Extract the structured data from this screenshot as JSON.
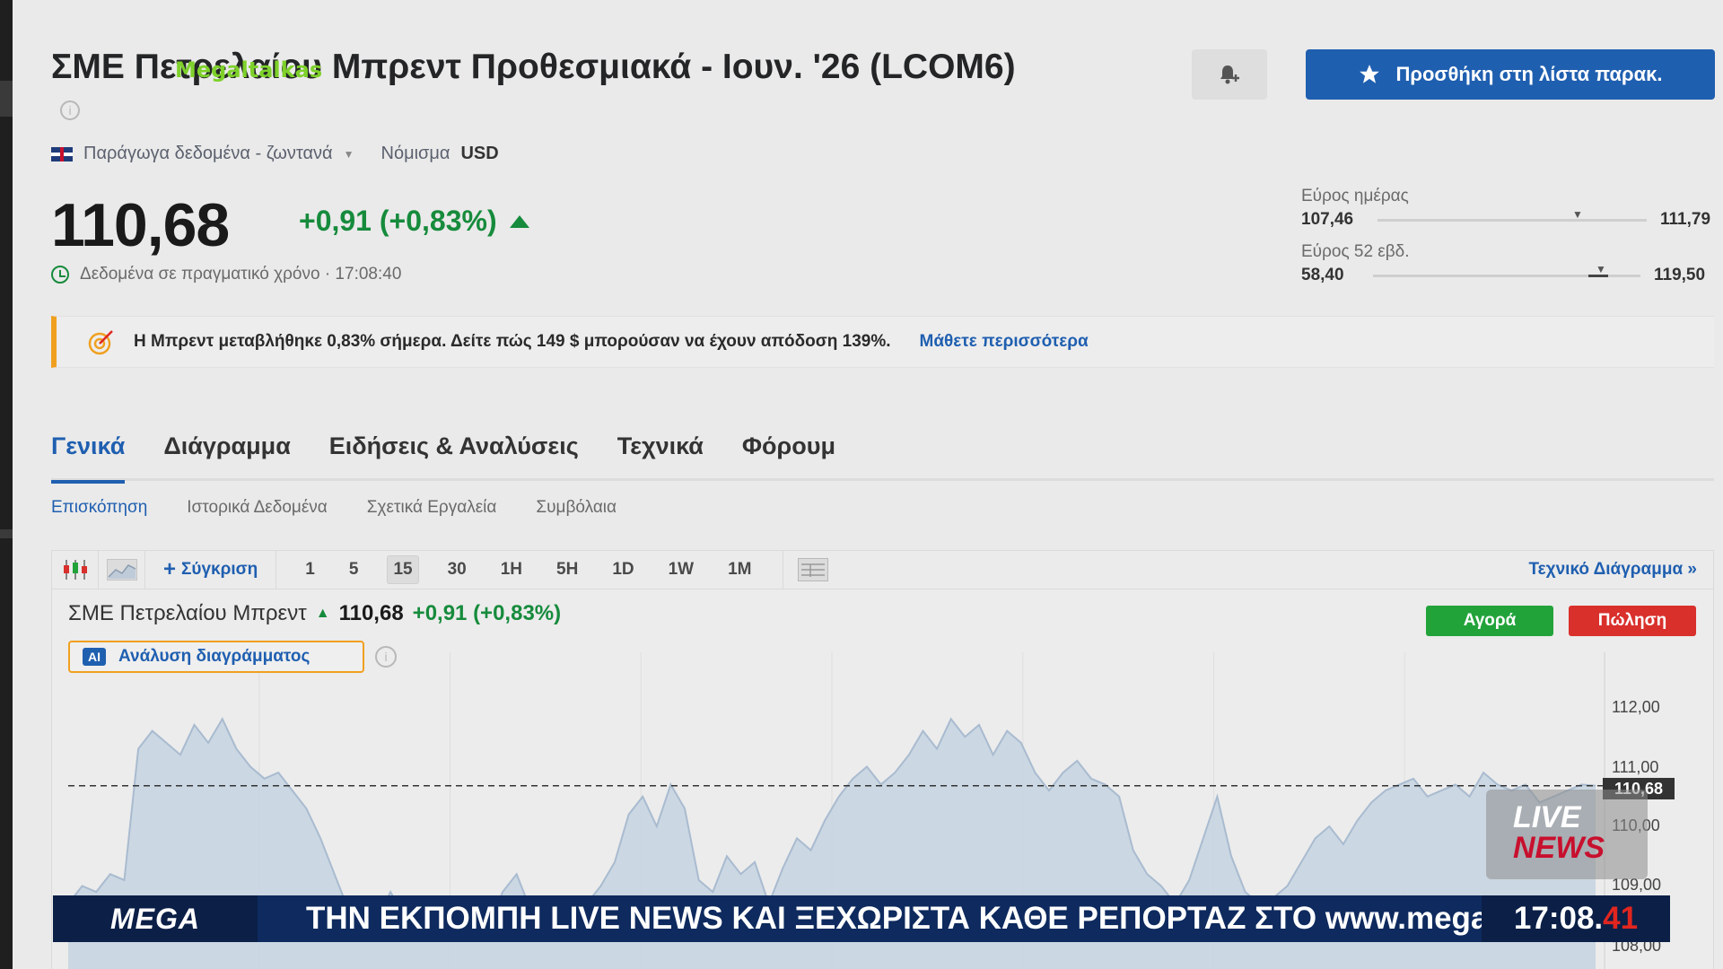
{
  "header": {
    "title": "ΣΜΕ Πετρελαίου Μπρεντ Προθεσμιακά - Ιουν. '26 (LCOM6)",
    "overlay_logo": "Megaltalkas",
    "watchlist_label": "Προσθήκη στη λίστα παρακ.",
    "data_source": "Παράγωγα δεδομένα - ζωντανά",
    "currency_label": "Νόμισμα",
    "currency_value": "USD"
  },
  "quote": {
    "price": "110,68",
    "change": "+0,91 (+0,83%)",
    "realtime_label": "Δεδομένα σε πραγματικό χρόνο · 17:08:40"
  },
  "ranges": {
    "day_label": "Εύρος ημέρας",
    "day_low": "107,46",
    "day_high": "111,79",
    "week52_label": "Εύρος 52 εβδ.",
    "week52_low": "58,40",
    "week52_high": "119,50"
  },
  "banner": {
    "text": "Η Μπρεντ μεταβλήθηκε 0,83% σήμερα. Δείτε πώς 149 $ μπορούσαν να έχουν απόδοση 139%.",
    "link": "Μάθετε περισσότερα"
  },
  "tabs": [
    {
      "label": "Γενικά"
    },
    {
      "label": "Διάγραμμα"
    },
    {
      "label": "Ειδήσεις & Αναλύσεις"
    },
    {
      "label": "Τεχνικά"
    },
    {
      "label": "Φόρουμ"
    }
  ],
  "subtabs": [
    {
      "label": "Επισκόπηση"
    },
    {
      "label": "Ιστορικά Δεδομένα"
    },
    {
      "label": "Σχετικά Εργαλεία"
    },
    {
      "label": "Συμβόλαια"
    }
  ],
  "chart_toolbar": {
    "compare_label": "Σύγκριση",
    "intervals": [
      "1",
      "5",
      "15",
      "30",
      "1H",
      "5H",
      "1D",
      "1W",
      "1M"
    ],
    "selected_interval": "15",
    "tech_chart_label": "Τεχνικό Διάγραμμα »"
  },
  "chart_header": {
    "instrument": "ΣΜΕ Πετρελαίου Μπρεντ",
    "price": "110,68",
    "change": "+0,91 (+0,83%)",
    "buy_label": "Αγορά",
    "sell_label": "Πώληση",
    "ai_badge": "AI",
    "ai_label": "Ανάλυση διαγράμματος"
  },
  "chart_data": {
    "type": "area",
    "y_tick_labels": [
      "112,00",
      "111,00",
      "110,00",
      "109,00",
      "108,00"
    ],
    "ylim": [
      108,
      112.3
    ],
    "last_price_label": "110,68",
    "last_price": 110.68,
    "values": [
      108.7,
      109.0,
      108.9,
      109.2,
      109.1,
      111.3,
      111.6,
      111.4,
      111.2,
      111.7,
      111.4,
      111.8,
      111.3,
      111.0,
      110.8,
      110.9,
      110.6,
      110.3,
      109.8,
      109.2,
      108.6,
      108.3,
      108.4,
      108.9,
      108.5,
      108.1,
      108.6,
      108.2,
      108.4,
      108.8,
      108.3,
      108.9,
      109.2,
      108.6,
      108.8,
      108.4,
      108.2,
      108.7,
      109.0,
      109.4,
      110.2,
      110.5,
      110.0,
      110.7,
      110.3,
      109.1,
      108.9,
      109.5,
      109.2,
      109.4,
      108.7,
      109.3,
      109.8,
      109.6,
      110.1,
      110.5,
      110.8,
      111.0,
      110.7,
      110.9,
      111.2,
      111.6,
      111.3,
      111.8,
      111.5,
      111.7,
      111.2,
      111.6,
      111.4,
      110.9,
      110.6,
      110.9,
      111.1,
      110.8,
      110.7,
      110.5,
      109.6,
      109.2,
      109.0,
      108.7,
      109.1,
      109.8,
      110.5,
      109.5,
      108.9,
      108.7,
      108.8,
      109.0,
      109.4,
      109.8,
      110.0,
      109.7,
      110.1,
      110.4,
      110.6,
      110.7,
      110.8,
      110.5,
      110.6,
      110.7,
      110.5,
      110.9,
      110.7,
      110.6,
      110.7,
      110.4,
      110.5,
      110.6,
      110.7,
      110.68
    ],
    "title": "ΣΜΕ Πετρελαίου Μπρεντ"
  },
  "overlay": {
    "live_logo_l1": "LIVE",
    "live_logo_l2": "NEWS"
  },
  "ticker": {
    "brand": "MEGA",
    "text": "ΤΗΝ ΕΚΠΟΜΠΗ LIVE NEWS ΚΑΙ ΞΕΧΩΡΙΣΤΑ ΚΑΘΕ ΡΕΠΟΡΤΑΖ ΣΤΟ www.megatv.com",
    "time_main": "17:08.",
    "time_sec": "41"
  },
  "colors": {
    "accent": "#1f5fb0",
    "up": "#168b3c",
    "buy": "#22a33a",
    "sell": "#d9302c",
    "banner_border": "#f0a020"
  }
}
